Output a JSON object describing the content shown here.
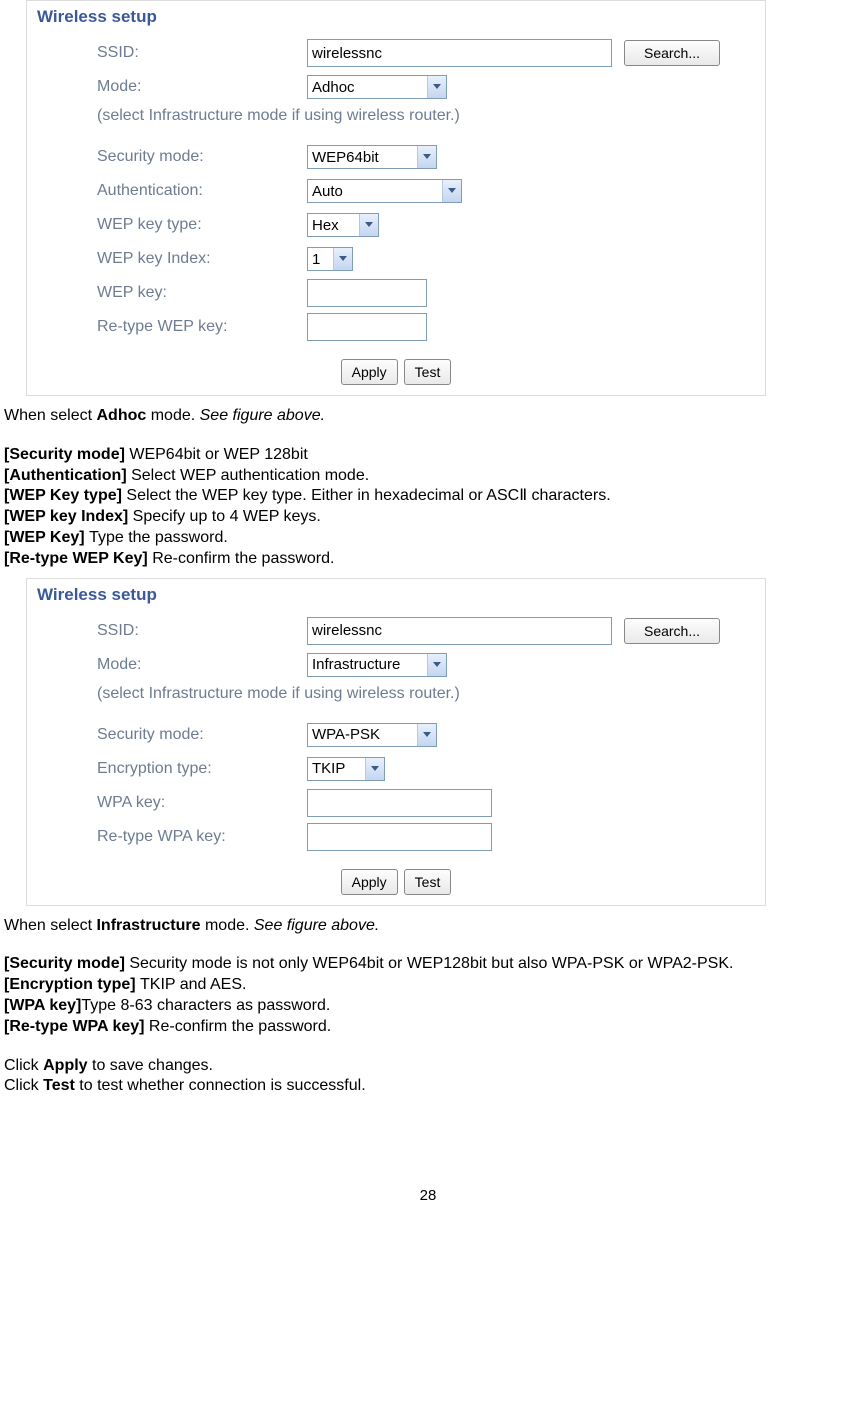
{
  "pageNumber": "28",
  "panel1": {
    "title": "Wireless setup",
    "ssid_label": "SSID:",
    "ssid_value": "wirelessnc",
    "search_btn": "Search...",
    "mode_label": "Mode:",
    "mode_value": "Adhoc",
    "hint": "(select Infrastructure mode if using wireless router.)",
    "secmode_label": "Security mode:",
    "secmode_value": "WEP64bit",
    "auth_label": "Authentication:",
    "auth_value": "Auto",
    "wepkeytype_label": "WEP key type:",
    "wepkeytype_value": "Hex",
    "wepkeyindex_label": "WEP key Index:",
    "wepkeyindex_value": "1",
    "wepkey_label": "WEP key:",
    "wepkey_value": "",
    "retype_label": "Re-type WEP key:",
    "retype_value": "",
    "apply_btn": "Apply",
    "test_btn": "Test"
  },
  "text1": {
    "caption_pre": "When select ",
    "caption_bold": "Adhoc",
    "caption_post": " mode. ",
    "caption_i": "See figure above.",
    "secmode_b": "[Security mode] ",
    "secmode_t": "WEP64bit or WEP 128bit",
    "auth_b": "[Authentication] ",
    "auth_t": "Select WEP authentication mode.",
    "wkt_b": "[WEP Key type] ",
    "wkt_t": "Select the WEP key type. Either in hexadecimal or ASCⅡ characters.",
    "wki_b": "[WEP key Index] ",
    "wki_t": "Specify up to 4 WEP keys.",
    "wk_b": "[WEP Key] ",
    "wk_t": "Type the password.",
    "rwk_b": "[Re-type WEP Key] ",
    "rwk_t": "Re-confirm the password."
  },
  "panel2": {
    "title": "Wireless setup",
    "ssid_label": "SSID:",
    "ssid_value": "wirelessnc",
    "search_btn": "Search...",
    "mode_label": "Mode:",
    "mode_value": "Infrastructure",
    "hint": "(select Infrastructure mode if using wireless router.)",
    "secmode_label": "Security mode:",
    "secmode_value": "WPA-PSK",
    "enctype_label": "Encryption type:",
    "enctype_value": "TKIP",
    "wpakey_label": "WPA key:",
    "wpakey_value": "",
    "retype_label": "Re-type WPA key:",
    "retype_value": "",
    "apply_btn": "Apply",
    "test_btn": "Test"
  },
  "text2": {
    "caption_pre": "When select ",
    "caption_bold": "Infrastructure",
    "caption_post": " mode. ",
    "caption_i": "See figure above.",
    "secmode_b": "[Security mode] ",
    "secmode_t": "Security mode is not only WEP64bit or WEP128bit but also WPA-PSK or WPA2-PSK.",
    "enc_b": "[Encryption type] ",
    "enc_t": "TKIP and AES.",
    "wpa_b": "[WPA key]",
    "wpa_t": "Type 8-63 characters as password.",
    "rwpa_b": "[Re-type WPA key] ",
    "rwpa_t": "Re-confirm the password.",
    "apply_pre": "Click ",
    "apply_b": "Apply",
    "apply_post": " to save changes.",
    "test_pre": "Click ",
    "test_b": "Test",
    "test_post": " to test whether connection is successful."
  }
}
